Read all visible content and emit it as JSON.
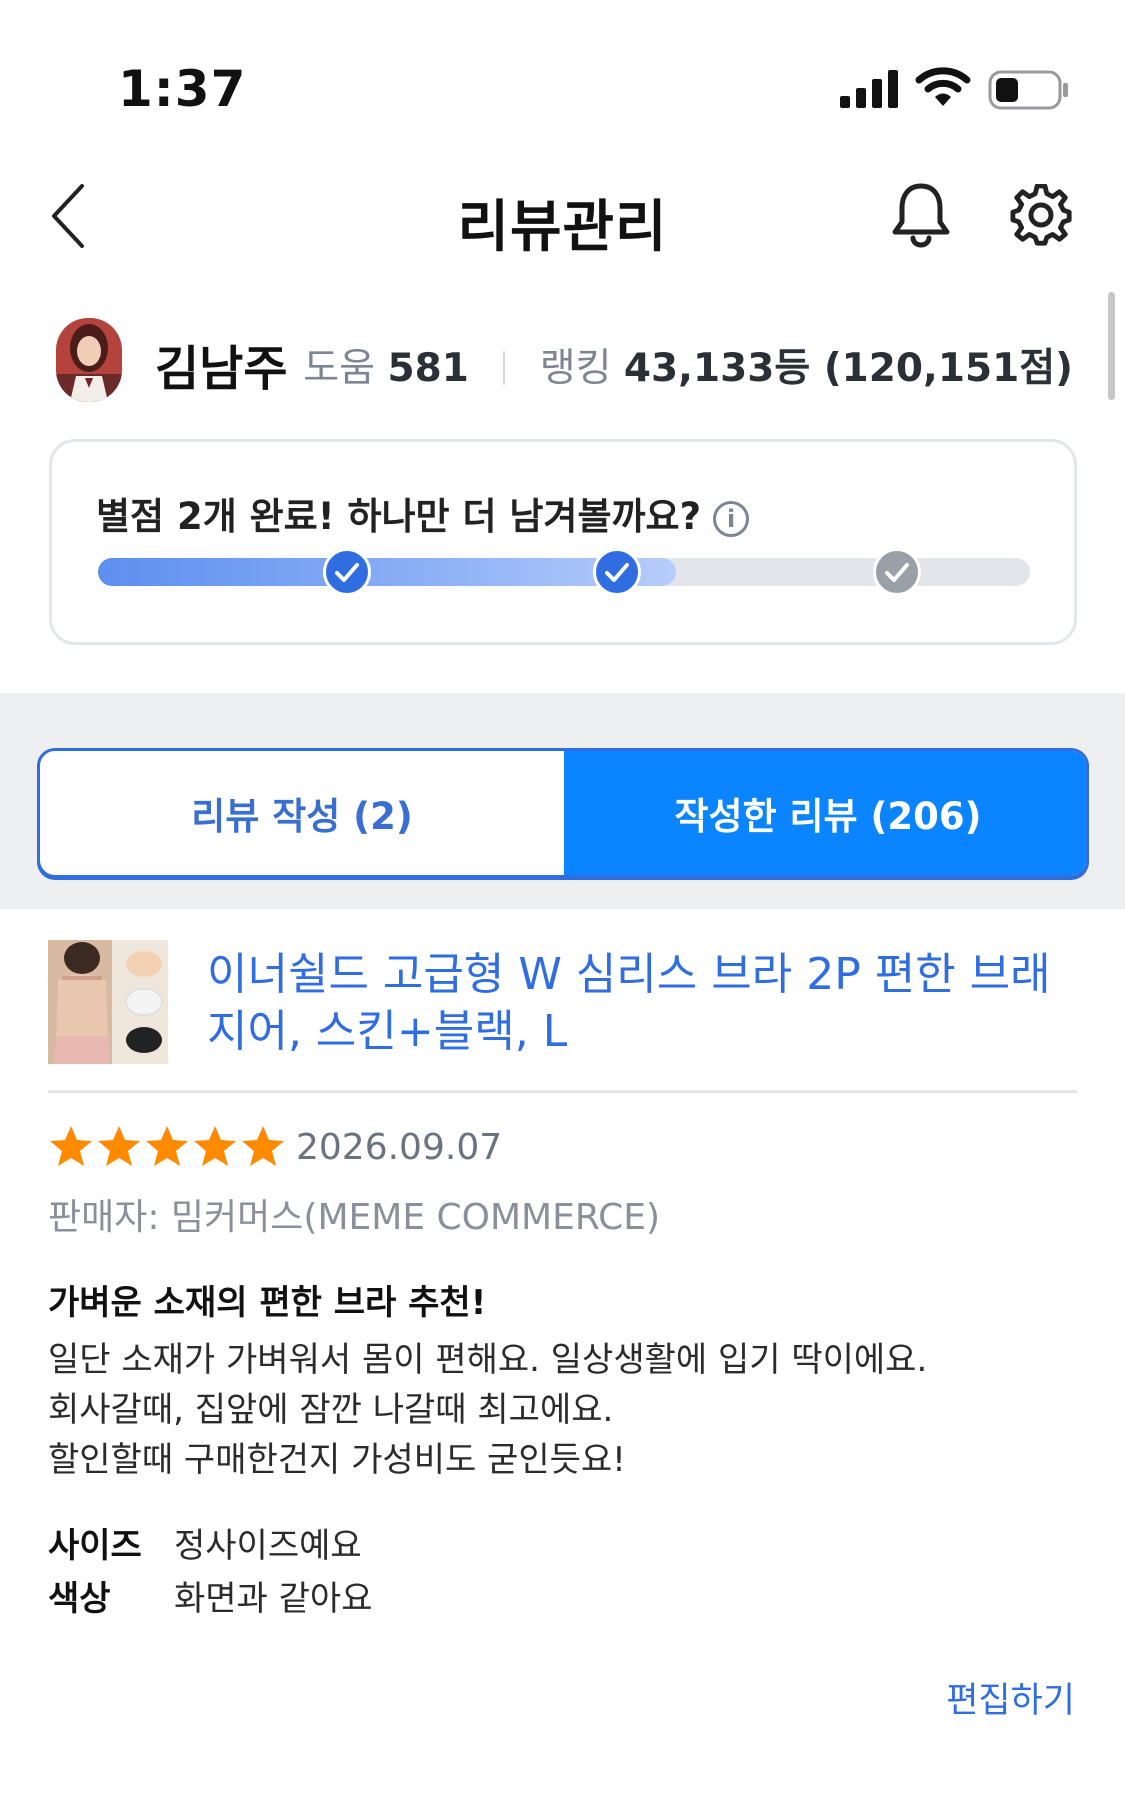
{
  "status_bar": {
    "time": "1:37"
  },
  "header": {
    "title": "리뷰관리",
    "back_icon": "chevron-left",
    "bell_icon": "bell",
    "settings_icon": "gear"
  },
  "profile": {
    "name": "김남주",
    "help_label": "도움",
    "help_value": "581",
    "ranking_label": "랭킹",
    "ranking_value": "43,133등 (120,151점)"
  },
  "progress": {
    "message": "별점 2개 완료! 하나만 더 남겨볼까요?",
    "info_icon": "i",
    "completed": 2,
    "total": 3,
    "fill_fraction": 0.62
  },
  "tabs": [
    {
      "label": "리뷰 작성 (2)",
      "active": false
    },
    {
      "label": "작성한 리뷰 (206)",
      "active": true
    }
  ],
  "product": {
    "name": "이너쉴드 고급형 W 심리스 브라 2P 편한 브래지어, 스킨+블랙, L"
  },
  "review": {
    "rating": 5,
    "date": "2026.09.07",
    "seller": "판매자: 밈커머스(MEME COMMERCE)",
    "title": "가벼운 소재의 편한 브라 추천!",
    "body_lines": [
      "일단 소재가 가벼워서 몸이 편해요. 일상생활에 입기 딱이에요.",
      "회사갈때, 집앞에 잠깐 나갈때 최고에요.",
      "할인할때 구매한건지 가성비도 굳인듯요!"
    ],
    "attributes": [
      {
        "key": "사이즈",
        "value": "정사이즈예요"
      },
      {
        "key": "색상",
        "value": "화면과 같아요"
      }
    ],
    "edit_label": "편집하기"
  },
  "colors": {
    "accent": "#0a84ff",
    "link": "#2f6de0",
    "star": "#ff8a00",
    "muted": "#7d8593"
  }
}
